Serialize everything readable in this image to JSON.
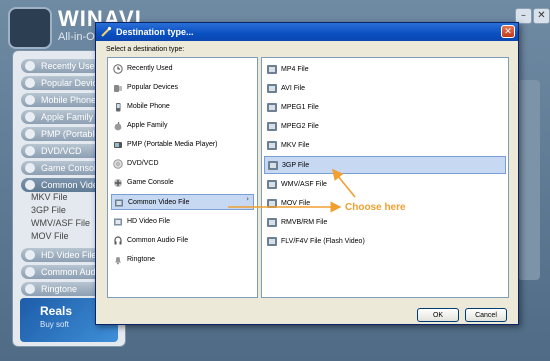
{
  "background_app": {
    "title": "WINAVI",
    "subtitle": "All-in-One Co",
    "sidebar": {
      "items": [
        {
          "label": "Recently Used"
        },
        {
          "label": "Popular Devices"
        },
        {
          "label": "Mobile Phone"
        },
        {
          "label": "Apple Family"
        },
        {
          "label": "PMP (Portable M"
        },
        {
          "label": "DVD/VCD"
        },
        {
          "label": "Game Console"
        },
        {
          "label": "Common Video"
        }
      ],
      "sub_items": [
        "MKV File",
        "3GP File",
        "WMV/ASF File",
        "MOV File"
      ],
      "items_after": [
        {
          "label": "HD Video File"
        },
        {
          "label": "Common Audio"
        },
        {
          "label": "Ringtone"
        }
      ]
    },
    "banner": {
      "line1": "Reals",
      "line2": "Buy soft"
    }
  },
  "dialog": {
    "title": "Destination type...",
    "close_label": "✕",
    "prompt": "Select a destination type:",
    "left_list": [
      {
        "label": "Recently Used",
        "icon": "clock-icon"
      },
      {
        "label": "Popular Devices",
        "icon": "devices-icon"
      },
      {
        "label": "Mobile Phone",
        "icon": "phone-icon"
      },
      {
        "label": "Apple Family",
        "icon": "apple-icon"
      },
      {
        "label": "PMP (Portable Media Player)",
        "icon": "media-player-icon"
      },
      {
        "label": "DVD/VCD",
        "icon": "disc-icon"
      },
      {
        "label": "Game Console",
        "icon": "gamepad-icon"
      },
      {
        "label": "Common Video File",
        "icon": "film-icon",
        "selected": true,
        "arrow": "›"
      },
      {
        "label": "HD Video File",
        "icon": "hd-film-icon"
      },
      {
        "label": "Common Audio File",
        "icon": "audio-icon"
      },
      {
        "label": "Ringtone",
        "icon": "bell-icon"
      }
    ],
    "right_list": [
      {
        "label": "MP4 File"
      },
      {
        "label": "AVI File"
      },
      {
        "label": "MPEG1 File"
      },
      {
        "label": "MPEG2 File"
      },
      {
        "label": "MKV File"
      },
      {
        "label": "3GP File",
        "selected": true
      },
      {
        "label": "WMV/ASF File"
      },
      {
        "label": "MOV File"
      },
      {
        "label": "RMVB/RM File"
      },
      {
        "label": "FLV/F4V File (Flash Video)"
      }
    ],
    "ok_label": "OK",
    "cancel_label": "Cancel"
  },
  "annotation": {
    "text": "Choose here",
    "color": "#f0a030"
  }
}
